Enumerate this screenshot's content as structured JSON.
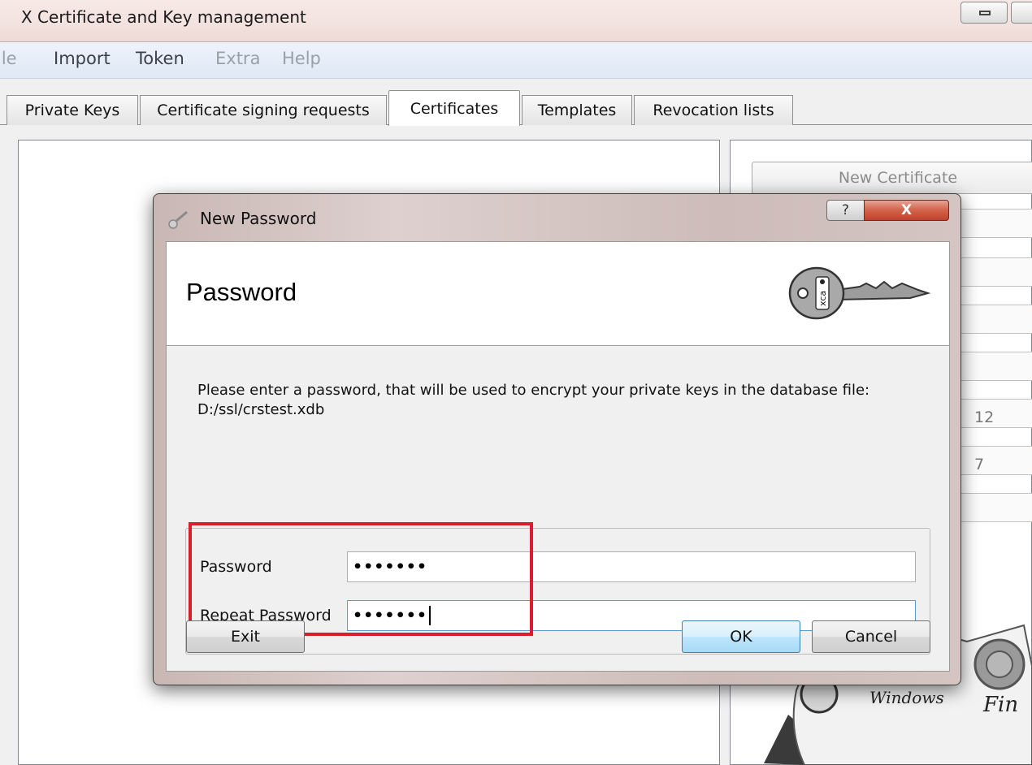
{
  "window": {
    "title": "X Certificate and Key management"
  },
  "menu": {
    "items": [
      {
        "label": "ile",
        "enabled": false
      },
      {
        "label": "Import",
        "enabled": true
      },
      {
        "label": "Token",
        "enabled": true
      },
      {
        "label": "Extra",
        "enabled": false
      },
      {
        "label": "Help",
        "enabled": false
      }
    ]
  },
  "tabs": [
    {
      "label": "Private Keys"
    },
    {
      "label": "Certificate signing requests"
    },
    {
      "label": "Certificates",
      "active": true
    },
    {
      "label": "Templates"
    },
    {
      "label": "Revocation lists"
    }
  ],
  "right_panel": {
    "new_certificate_label": "New Certificate",
    "partial_values": [
      "12",
      "7"
    ]
  },
  "background_seal": {
    "script_text_1": "Windows",
    "script_text_2": "Fin"
  },
  "dialog": {
    "caption": "New Password",
    "help_glyph": "?",
    "close_glyph": "X",
    "heading": "Password",
    "logo_text": "xca",
    "info_text": "Please enter a password, that will be used to encrypt your private keys in the database file:",
    "info_path": "D:/ssl/crstest.xdb",
    "password_label": "Password",
    "password_value": "•••••••",
    "repeat_label": "Repeat Password",
    "repeat_value": "•••••••",
    "exit_label": "Exit",
    "ok_label": "OK",
    "cancel_label": "Cancel"
  },
  "colors": {
    "highlight_box": "#d81e2c",
    "focus_border": "#5b9bd5"
  }
}
